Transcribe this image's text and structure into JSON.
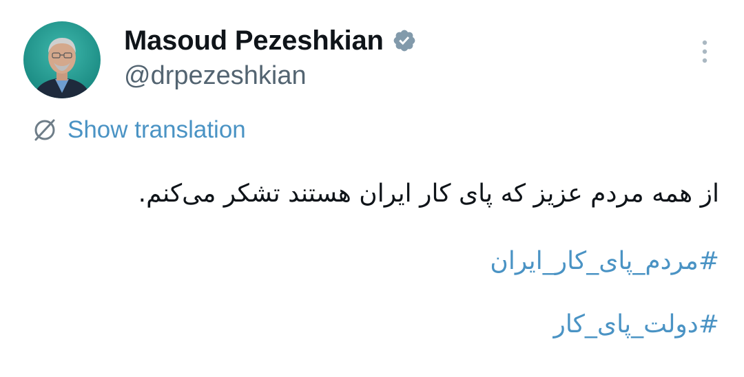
{
  "author": {
    "display_name": "Masoud Pezeshkian",
    "handle": "@drpezeshkian",
    "verified_icon": "verified-badge-icon",
    "avatar_background": "#1f9c94"
  },
  "actions": {
    "more_icon": "vertical-ellipsis-icon"
  },
  "translation": {
    "icon": "translate-globe-icon",
    "label": "Show translation"
  },
  "tweet": {
    "text": "از همه مردم عزیز که پای کار ایران هستند تشکر می‌کنم.",
    "hashtags": [
      "#مردم_پای_کار_ایران",
      "#دولت_پای_کار"
    ]
  },
  "colors": {
    "link": "#4a93c4",
    "text": "#0f1419",
    "secondary": "#536471",
    "verified": "#829aab"
  }
}
